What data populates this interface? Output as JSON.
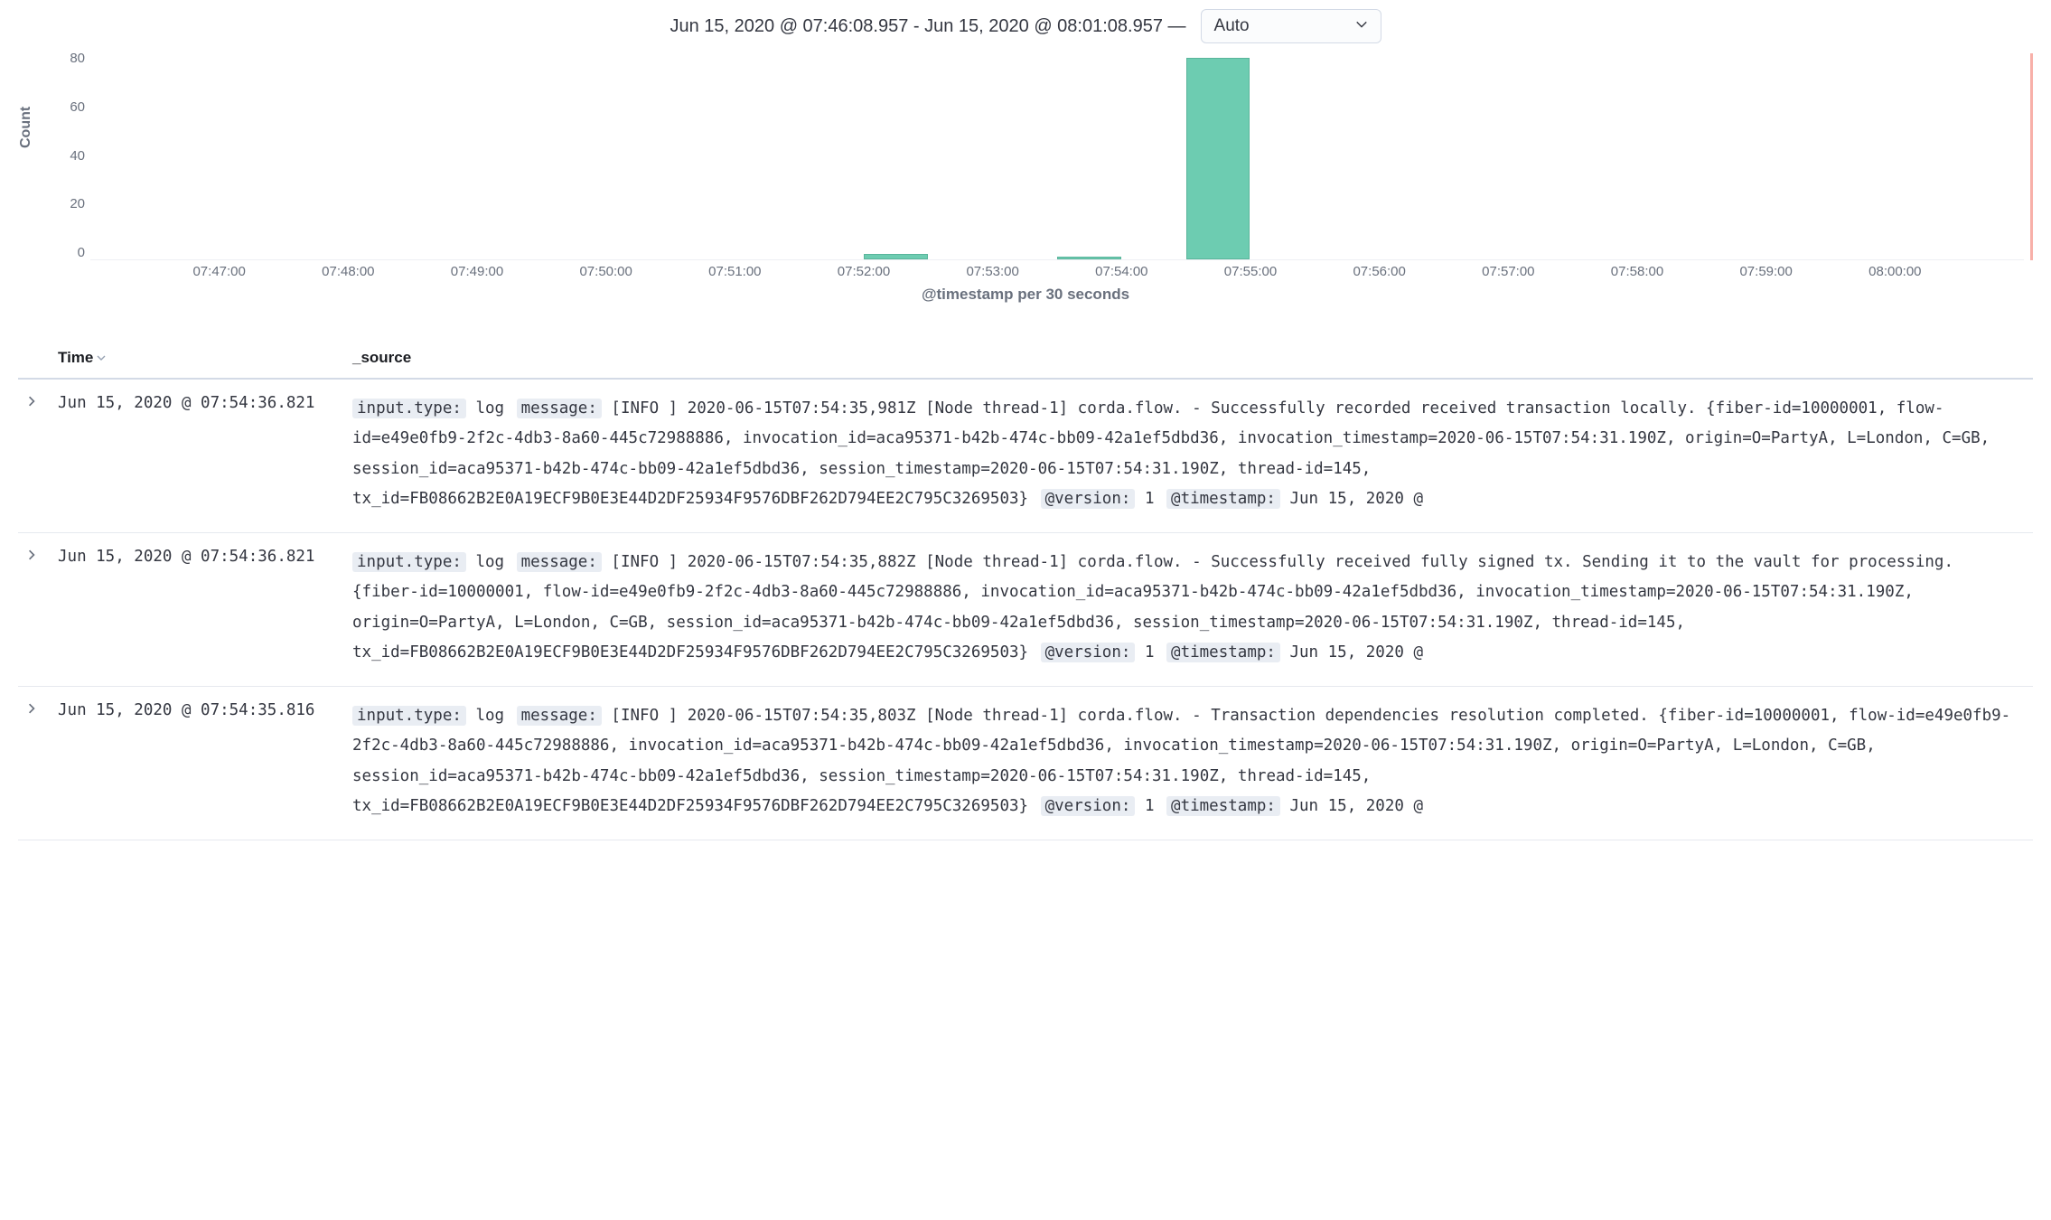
{
  "header": {
    "time_range": "Jun 15, 2020 @ 07:46:08.957 - Jun 15, 2020 @ 08:01:08.957 —",
    "interval": "Auto"
  },
  "chart_data": {
    "type": "bar",
    "title": "",
    "ylabel": "Count",
    "xlabel": "@timestamp per 30 seconds",
    "ylim": [
      0,
      80
    ],
    "yticks": [
      0,
      20,
      40,
      60,
      80
    ],
    "xticks": [
      "07:47:00",
      "07:48:00",
      "07:49:00",
      "07:50:00",
      "07:51:00",
      "07:52:00",
      "07:53:00",
      "07:54:00",
      "07:55:00",
      "07:56:00",
      "07:57:00",
      "07:58:00",
      "07:59:00",
      "08:00:00"
    ],
    "x_start": "07:46:00",
    "x_end": "08:01:00",
    "interval_seconds": 30,
    "series": [
      {
        "name": "Count",
        "x": [
          "07:52:00",
          "07:53:30",
          "07:54:30"
        ],
        "values": [
          2,
          1,
          79
        ]
      }
    ]
  },
  "columns": {
    "time": "Time",
    "source": "_source"
  },
  "fields": {
    "input_type": "input.type:",
    "message": "message:",
    "version": "@version:",
    "timestamp": "@timestamp:"
  },
  "rows": [
    {
      "time": "Jun 15, 2020 @ 07:54:36.821",
      "input_type_val": "log",
      "message_val": "[INFO ] 2020-06-15T07:54:35,981Z [Node thread-1] corda.flow. - Successfully recorded received transaction locally. {fiber-id=10000001, flow-id=e49e0fb9-2f2c-4db3-8a60-445c72988886, invocation_id=aca95371-b42b-474c-bb09-42a1ef5dbd36, invocation_timestamp=2020-06-15T07:54:31.190Z, origin=O=PartyA, L=London, C=GB, session_id=aca95371-b42b-474c-bb09-42a1ef5dbd36, session_timestamp=2020-06-15T07:54:31.190Z, thread-id=145, tx_id=FB08662B2E0A19ECF9B0E3E44D2DF25934F9576DBF262D794EE2C795C3269503}",
      "version_val": "1",
      "timestamp_val": "Jun 15, 2020 @"
    },
    {
      "time": "Jun 15, 2020 @ 07:54:36.821",
      "input_type_val": "log",
      "message_val": "[INFO ] 2020-06-15T07:54:35,882Z [Node thread-1] corda.flow. - Successfully received fully signed tx. Sending it to the vault for processing. {fiber-id=10000001, flow-id=e49e0fb9-2f2c-4db3-8a60-445c72988886, invocation_id=aca95371-b42b-474c-bb09-42a1ef5dbd36, invocation_timestamp=2020-06-15T07:54:31.190Z, origin=O=PartyA, L=London, C=GB, session_id=aca95371-b42b-474c-bb09-42a1ef5dbd36, session_timestamp=2020-06-15T07:54:31.190Z, thread-id=145, tx_id=FB08662B2E0A19ECF9B0E3E44D2DF25934F9576DBF262D794EE2C795C3269503}",
      "version_val": "1",
      "timestamp_val": "Jun 15, 2020 @"
    },
    {
      "time": "Jun 15, 2020 @ 07:54:35.816",
      "input_type_val": "log",
      "message_val": "[INFO ] 2020-06-15T07:54:35,803Z [Node thread-1] corda.flow. - Transaction dependencies resolution completed. {fiber-id=10000001, flow-id=e49e0fb9-2f2c-4db3-8a60-445c72988886, invocation_id=aca95371-b42b-474c-bb09-42a1ef5dbd36, invocation_timestamp=2020-06-15T07:54:31.190Z, origin=O=PartyA, L=London, C=GB, session_id=aca95371-b42b-474c-bb09-42a1ef5dbd36, session_timestamp=2020-06-15T07:54:31.190Z, thread-id=145, tx_id=FB08662B2E0A19ECF9B0E3E44D2DF25934F9576DBF262D794EE2C795C3269503}",
      "version_val": "1",
      "timestamp_val": "Jun 15, 2020 @"
    }
  ]
}
